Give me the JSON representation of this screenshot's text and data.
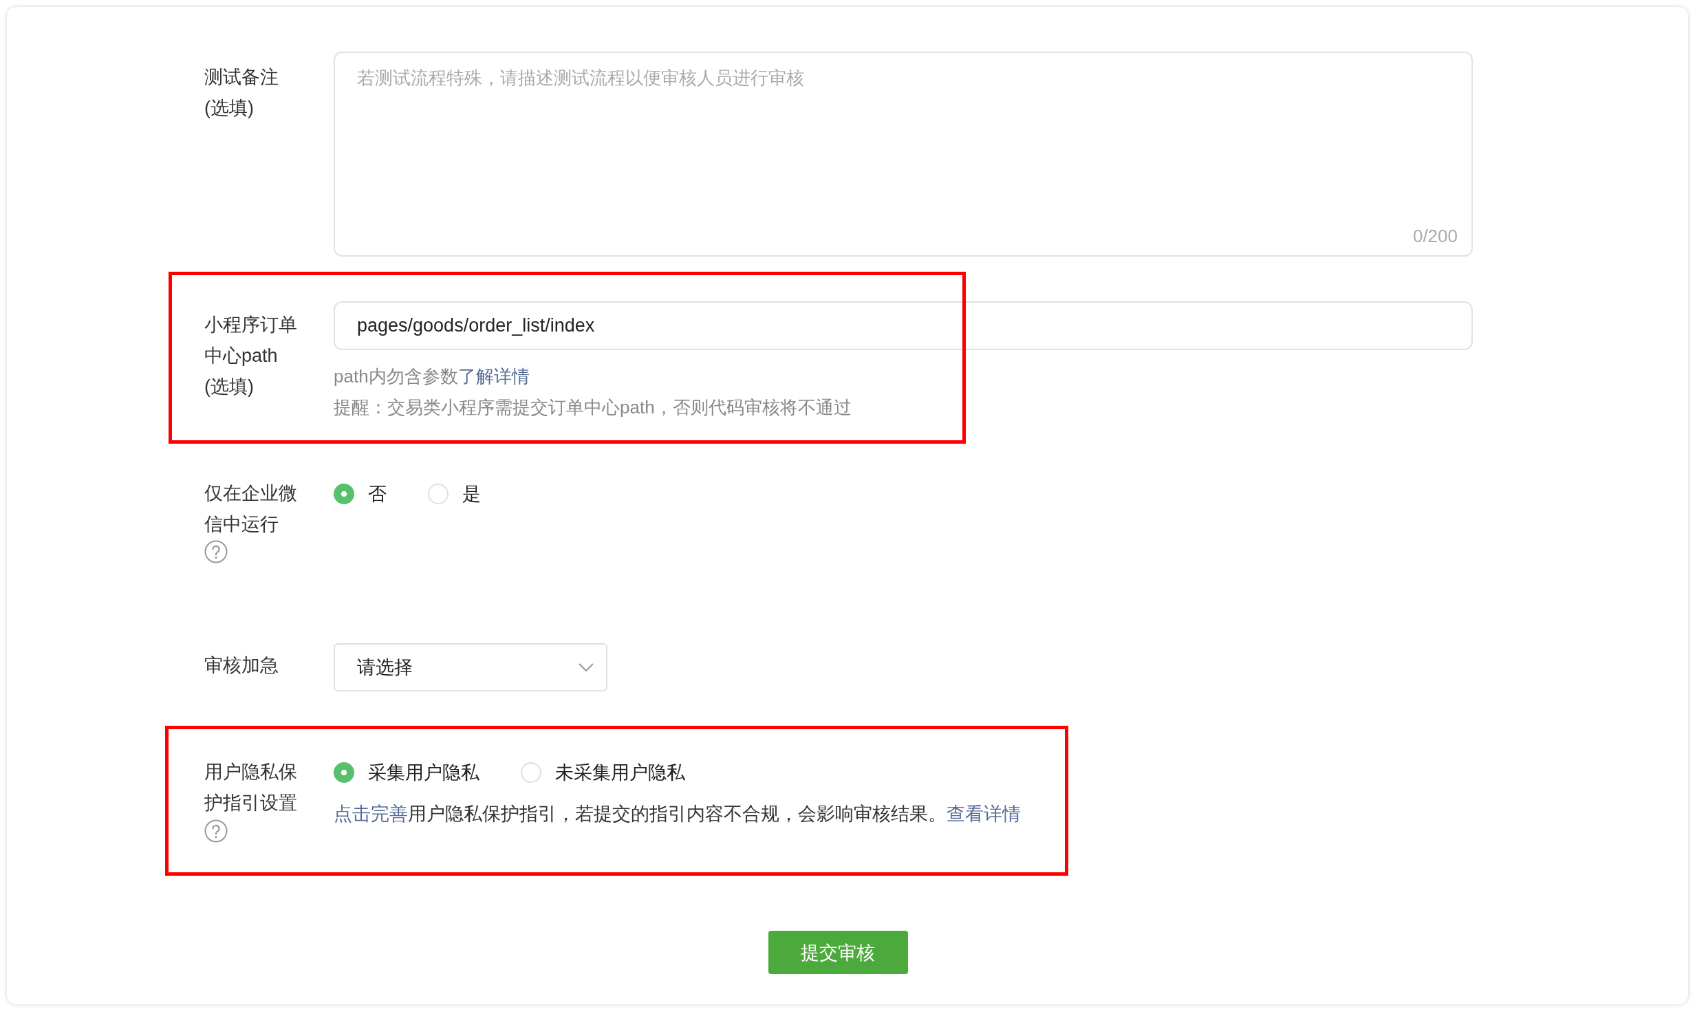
{
  "fields": [
    {
      "kind": "textarea",
      "label": "测试备注(选填)",
      "help": false,
      "highlighted": false,
      "placeholder": "若测试流程特殊，请描述测试流程以便审核人员进行审核",
      "counter": "0/200"
    },
    {
      "kind": "input",
      "label": "小程序订单中心path(选填)",
      "help": false,
      "highlighted": true,
      "value": "pages/goods/order_list/index",
      "hints": [
        [
          {
            "text": "path内勿含参数",
            "kind": "text"
          },
          {
            "text": "了解详情",
            "kind": "link"
          }
        ],
        [
          {
            "text": "提醒：交易类小程序需提交订单中心path，否则代码审核将不通过",
            "kind": "text"
          }
        ]
      ]
    },
    {
      "kind": "radio",
      "label": "仅在企业微信中运行",
      "help": true,
      "highlighted": false,
      "options": [
        {
          "label": "否",
          "selected": true
        },
        {
          "label": "是",
          "selected": false
        }
      ]
    },
    {
      "kind": "select",
      "label": "审核加急",
      "help": false,
      "highlighted": false,
      "placeholder": "请选择"
    },
    {
      "kind": "radio",
      "label": "用户隐私保护指引设置",
      "help": true,
      "highlighted": true,
      "options": [
        {
          "label": "采集用户隐私",
          "selected": true
        },
        {
          "label": "未采集用户隐私",
          "selected": false
        }
      ],
      "hints": [
        [
          {
            "text": "点击完善",
            "kind": "link"
          },
          {
            "text": "用户隐私保护指引，若提交的指引内容不合规，会影响审核结果。",
            "kind": "text"
          },
          {
            "text": "查看详情",
            "kind": "link"
          }
        ]
      ]
    }
  ],
  "submit": "提交审核"
}
